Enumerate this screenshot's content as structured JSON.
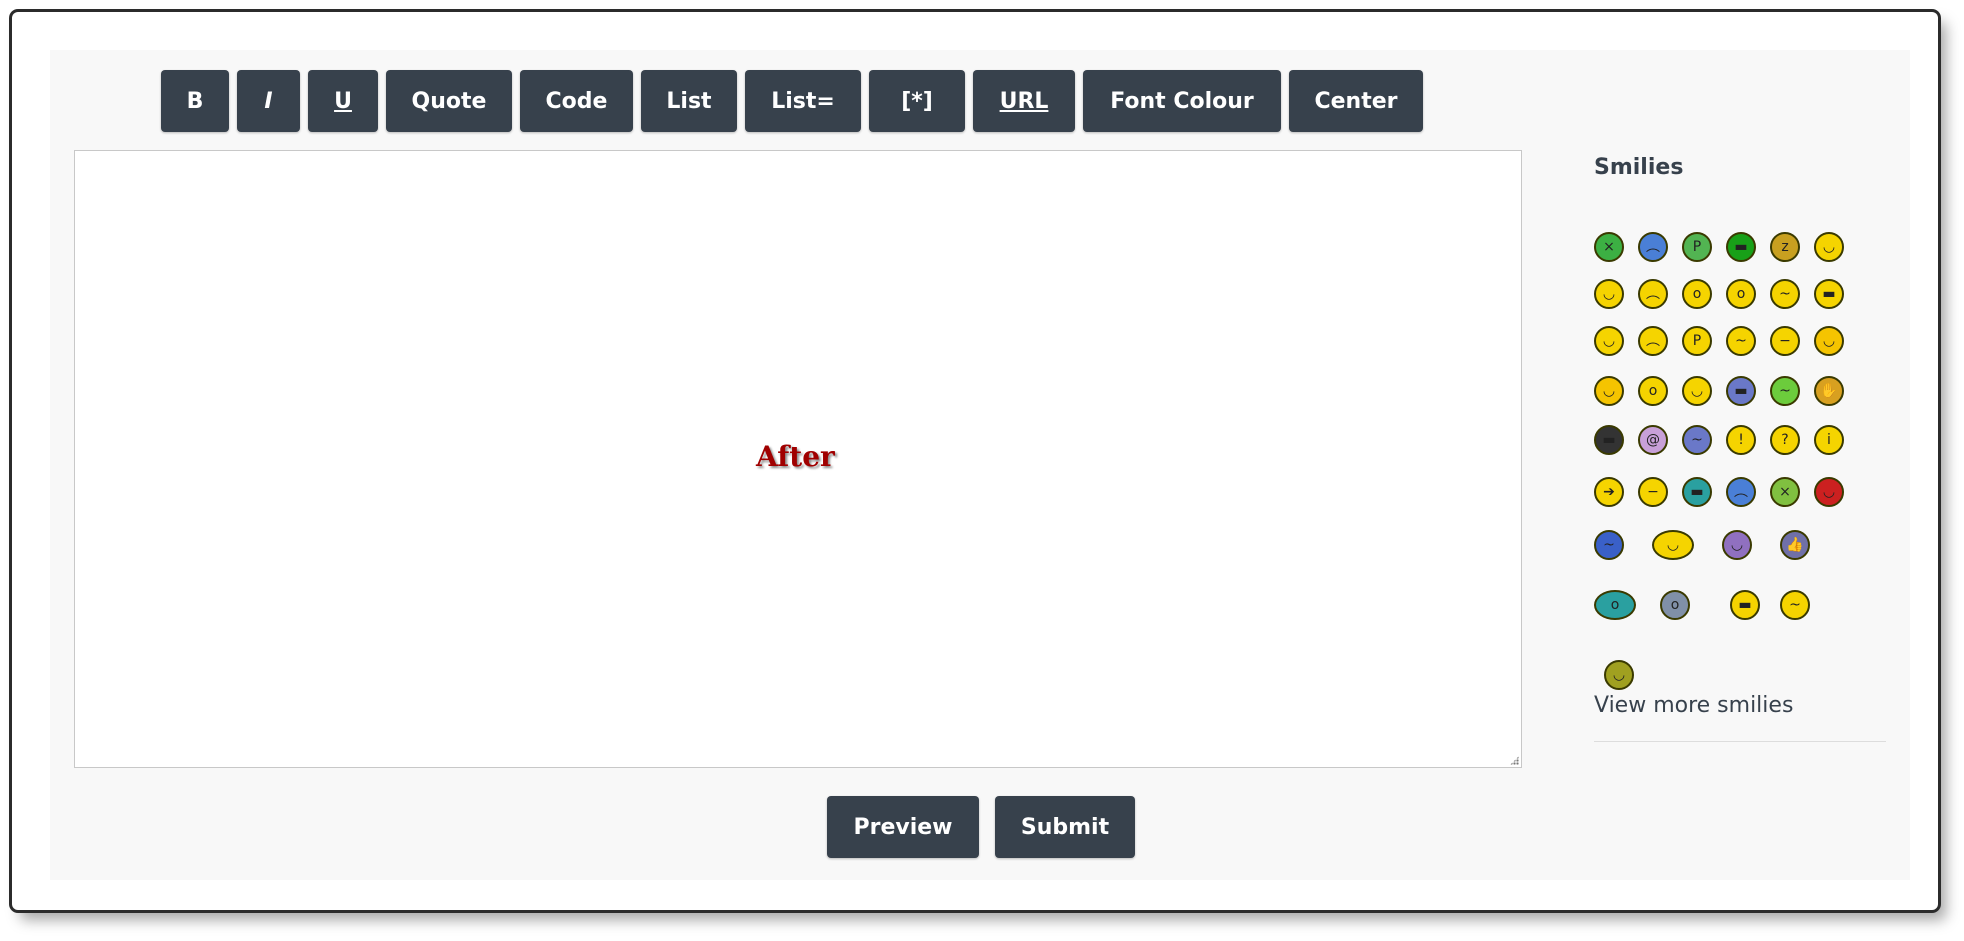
{
  "toolbar": {
    "buttons": [
      {
        "label": "B",
        "style": "bold"
      },
      {
        "label": "I",
        "style": "italic"
      },
      {
        "label": "U",
        "style": "underline"
      },
      {
        "label": "Quote",
        "style": "bold"
      },
      {
        "label": "Code",
        "style": "bold"
      },
      {
        "label": "List",
        "style": "bold"
      },
      {
        "label": "List=",
        "style": "bold"
      },
      {
        "label": "[*]",
        "style": "bold"
      },
      {
        "label": "URL",
        "style": "underline"
      },
      {
        "label": "Font Colour",
        "style": "bold"
      },
      {
        "label": "Center",
        "style": "bold"
      }
    ]
  },
  "editor": {
    "overlay_label": "After"
  },
  "actions": {
    "preview_label": "Preview",
    "submit_label": "Submit"
  },
  "smilies": {
    "title": "Smilies",
    "view_more_label": "View more smilies",
    "items": [
      {
        "name": "sick-smiley-icon",
        "color": "#3cb043",
        "glyph": "×"
      },
      {
        "name": "sad-blue-smiley-icon",
        "color": "#4a7fd6",
        "glyph": "︵"
      },
      {
        "name": "tongue-green-smiley-icon",
        "color": "#52b452",
        "glyph": "P"
      },
      {
        "name": "angry-green-smiley-icon",
        "color": "#18a018",
        "glyph": "▬"
      },
      {
        "name": "sleeping-smiley-icon",
        "color": "#c8a020",
        "glyph": "z"
      },
      {
        "name": "grin-smiley-icon",
        "color": "#f5d400",
        "glyph": "◡"
      },
      {
        "name": "grin-wide-smiley-icon",
        "color": "#f5d400",
        "glyph": "◡"
      },
      {
        "name": "frown-smiley-icon",
        "color": "#f5d400",
        "glyph": "︵"
      },
      {
        "name": "surprised-smiley-icon",
        "color": "#f5d400",
        "glyph": "o"
      },
      {
        "name": "rolleyes-smiley-icon",
        "color": "#f5d400",
        "glyph": "o"
      },
      {
        "name": "confused-smiley-icon",
        "color": "#f5d400",
        "glyph": "~"
      },
      {
        "name": "cool-smiley-icon",
        "color": "#f5d400",
        "glyph": "▬"
      },
      {
        "name": "laugh-smiley-icon",
        "color": "#f5d400",
        "glyph": "◡"
      },
      {
        "name": "mad-smiley-icon",
        "color": "#f5d400",
        "glyph": "︵"
      },
      {
        "name": "razz-smiley-icon",
        "color": "#f5d400",
        "glyph": "P"
      },
      {
        "name": "embarrassed-smiley-icon",
        "color": "#f5d400",
        "glyph": "~"
      },
      {
        "name": "neutral-smiley-icon",
        "color": "#f5d400",
        "glyph": "−"
      },
      {
        "name": "evil-smiley-icon",
        "color": "#f5c400",
        "glyph": "◡"
      },
      {
        "name": "twisted-smiley-icon",
        "color": "#f5c400",
        "glyph": "◡"
      },
      {
        "name": "eek-smiley-icon",
        "color": "#f5d400",
        "glyph": "o"
      },
      {
        "name": "wink-smiley-icon",
        "color": "#f5d400",
        "glyph": "◡"
      },
      {
        "name": "ninja-blue-smiley-icon",
        "color": "#6a78c8",
        "glyph": "▬"
      },
      {
        "name": "sick-green-smiley-icon",
        "color": "#6ccc3c",
        "glyph": "~"
      },
      {
        "name": "facepalm-smiley-icon",
        "color": "#d8a020",
        "glyph": "✋"
      },
      {
        "name": "ninja-smiley-icon",
        "color": "#333333",
        "glyph": "▬"
      },
      {
        "name": "crazy-smiley-icon",
        "color": "#c8a0d8",
        "glyph": "@"
      },
      {
        "name": "wall-smiley-icon",
        "color": "#6a78c8",
        "glyph": "~"
      },
      {
        "name": "exclaim-smiley-icon",
        "color": "#f5d400",
        "glyph": "!"
      },
      {
        "name": "question-smiley-icon",
        "color": "#f5d400",
        "glyph": "?"
      },
      {
        "name": "idea-smiley-icon",
        "color": "#f5d400",
        "glyph": "i"
      },
      {
        "name": "arrow-smiley-icon",
        "color": "#f5d400",
        "glyph": "➔"
      },
      {
        "name": "hmm-smiley-icon",
        "color": "#f5d400",
        "glyph": "−"
      },
      {
        "name": "teeth-smiley-icon",
        "color": "#2aa0a0",
        "glyph": "▬"
      },
      {
        "name": "cry-smiley-icon",
        "color": "#4a7fd6",
        "glyph": "︵"
      },
      {
        "name": "dead-smiley-icon",
        "color": "#80c040",
        "glyph": "×"
      },
      {
        "name": "devil-smiley-icon",
        "color": "#cc2020",
        "glyph": "◡"
      },
      {
        "name": "drunk-smiley-icon",
        "color": "#3a60c8",
        "glyph": "~"
      },
      {
        "name": "dance-smiley-icon",
        "color": "#f5d400",
        "glyph": "◡"
      },
      {
        "name": "beer-smiley-icon",
        "color": "#9070c0",
        "glyph": "◡"
      },
      {
        "name": "thumbs-up-smiley-icon",
        "color": "#7070a8",
        "glyph": "👍"
      },
      {
        "name": "whistle-smiley-icon",
        "color": "#2aa0a0",
        "glyph": "o"
      },
      {
        "name": "shock-smiley-icon",
        "color": "#8090a8",
        "glyph": "o"
      },
      {
        "name": "nerd-smiley-icon",
        "color": "#f5d400",
        "glyph": "▬"
      },
      {
        "name": "pray-smiley-icon",
        "color": "#f5d400",
        "glyph": "~"
      },
      {
        "name": "goblin-smiley-icon",
        "color": "#a0a020",
        "glyph": "◡"
      }
    ]
  }
}
